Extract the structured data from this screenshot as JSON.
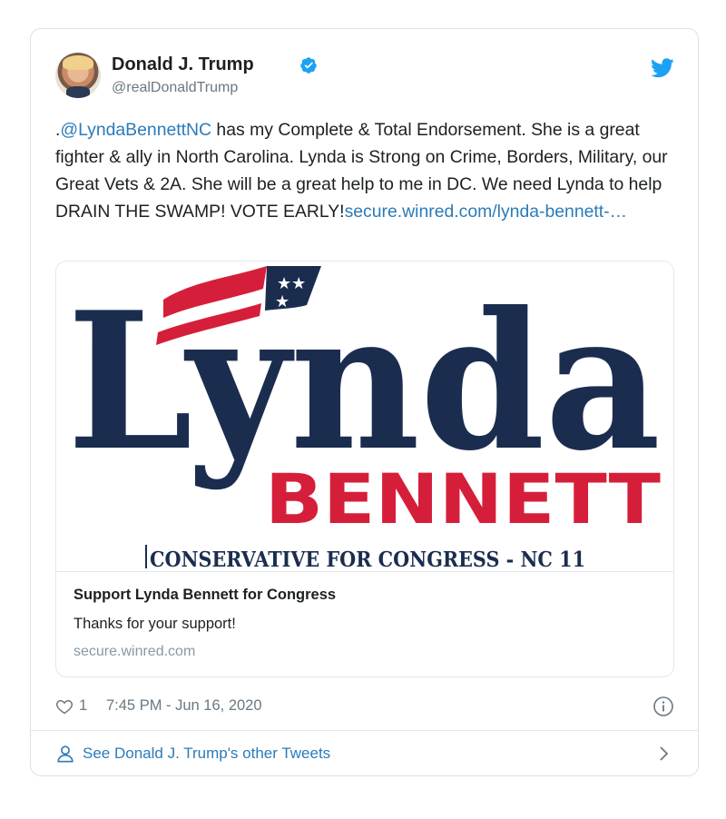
{
  "tweet": {
    "author_name": "Donald J. Trump",
    "handle": "@realDonaldTrump",
    "text_prefix": ".",
    "mention": "@LyndaBennettNC",
    "text_body": " has my Complete & Total Endorsement. She is a great fighter & ally in North Carolina. Lynda is Strong on Crime, Borders, Military, our Great Vets & 2A. She will be a great help to me in DC. We need Lynda to help DRAIN THE SWAMP! VOTE EARLY!",
    "text_link": "secure.winred.com/lynda-bennett-…"
  },
  "card": {
    "logo_first": "Lynda",
    "logo_last": "BENNETT",
    "logo_tagline": "CONSERVATIVE FOR CONGRESS - NC 11",
    "title": "Support Lynda Bennett for Congress",
    "description": "Thanks for your support!",
    "domain": "secure.winred.com"
  },
  "meta": {
    "likes": "1",
    "timestamp": "7:45 PM - Jun 16, 2020"
  },
  "footer": {
    "link_text": "See Donald J. Trump's other Tweets"
  },
  "icons": {
    "verified": "verified-badge-icon",
    "brand": "twitter-bird-icon",
    "like": "heart-icon",
    "info": "info-icon",
    "profile": "person-icon",
    "next": "chevron-right-icon"
  },
  "colors": {
    "link_blue": "#2b7bb9",
    "twitter_blue": "#1da1f2",
    "logo_navy": "#1b2d4f",
    "logo_red": "#d51f3a"
  }
}
